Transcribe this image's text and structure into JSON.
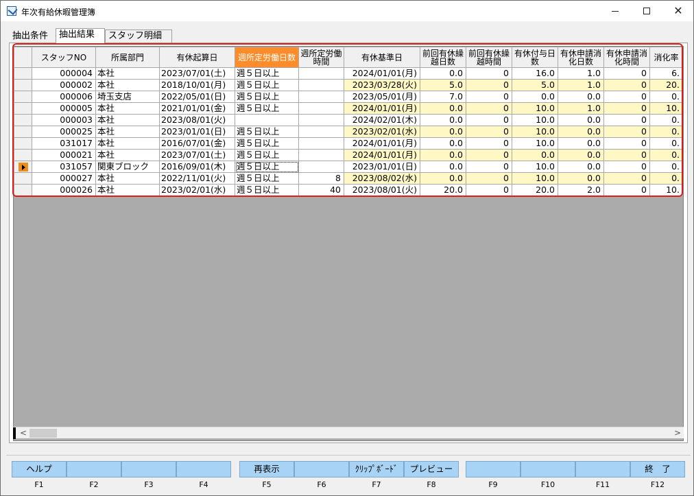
{
  "window": {
    "title": "年次有給休暇管理簿"
  },
  "tabs": [
    {
      "label": "抽出条件"
    },
    {
      "label": "抽出結果"
    },
    {
      "label": "スタッフ明細"
    }
  ],
  "grid": {
    "headers": [
      "スタッフNO",
      "所属部門",
      "有休起算日",
      "週所定労働日数",
      "週所定労働時間",
      "有休基準日",
      "前回有休繰越日数",
      "前回有休繰越時間",
      "有休付与日数",
      "有休申請消化日数",
      "有休申請消化時間",
      "消化率"
    ],
    "rows": [
      {
        "c": [
          "000004",
          "本社",
          "2023/07/01(土)",
          "週５日以上",
          "",
          "2024/01/01(月)",
          "0.0",
          "0",
          "16.0",
          "1.0",
          "0",
          "6."
        ],
        "y": false,
        "current": false
      },
      {
        "c": [
          "000002",
          "本社",
          "2018/10/01(月)",
          "週５日以上",
          "",
          "2023/03/28(火)",
          "5.0",
          "0",
          "5.0",
          "1.0",
          "0",
          "20."
        ],
        "y": true,
        "current": false
      },
      {
        "c": [
          "000006",
          "埼玉支店",
          "2022/05/01(日)",
          "週５日以上",
          "",
          "2023/05/01(月)",
          "7.0",
          "0",
          "0.0",
          "0.0",
          "0",
          "0."
        ],
        "y": false,
        "current": false
      },
      {
        "c": [
          "000005",
          "本社",
          "2021/01/01(金)",
          "週５日以上",
          "",
          "2024/01/01(月)",
          "0.0",
          "0",
          "10.0",
          "1.0",
          "0",
          "10."
        ],
        "y": true,
        "current": false
      },
      {
        "c": [
          "000003",
          "本社",
          "2023/08/01(火)",
          "",
          "",
          "2024/02/01(木)",
          "0.0",
          "0",
          "10.0",
          "0.0",
          "0",
          "0."
        ],
        "y": false,
        "current": false
      },
      {
        "c": [
          "000025",
          "本社",
          "2023/01/01(日)",
          "週５日以上",
          "",
          "2023/02/01(水)",
          "0.0",
          "0",
          "10.0",
          "0.0",
          "0",
          "0."
        ],
        "y": true,
        "current": false
      },
      {
        "c": [
          "031017",
          "本社",
          "2016/07/01(金)",
          "週５日以上",
          "",
          "2024/01/01(月)",
          "0.0",
          "0",
          "10.0",
          "0.0",
          "0",
          "0."
        ],
        "y": false,
        "current": false
      },
      {
        "c": [
          "000021",
          "本社",
          "2023/07/01(土)",
          "週５日以上",
          "",
          "2024/01/01(月)",
          "0.0",
          "0",
          "0.0",
          "0.0",
          "0",
          "0."
        ],
        "y": true,
        "current": false
      },
      {
        "c": [
          "031057",
          "関東ブロック",
          "2016/09/01(木)",
          "週５日以上",
          "",
          "2023/01/01(日)",
          "0.0",
          "0",
          "10.0",
          "0.0",
          "0",
          "0."
        ],
        "y": false,
        "current": true
      },
      {
        "c": [
          "000027",
          "本社",
          "2022/11/01(火)",
          "週５日以上",
          "8",
          "2023/08/02(水)",
          "0.0",
          "0",
          "10.0",
          "0.0",
          "0",
          "0."
        ],
        "y": true,
        "current": false
      },
      {
        "c": [
          "000026",
          "本社",
          "2023/02/01(水)",
          "週５日以上",
          "40",
          "2023/08/01(火)",
          "20.0",
          "0",
          "20.0",
          "2.0",
          "0",
          "10."
        ],
        "y": false,
        "current": false
      }
    ]
  },
  "function_keys": [
    {
      "label": "ヘルプ",
      "key": "F1"
    },
    {
      "label": "",
      "key": "F2"
    },
    {
      "label": "",
      "key": "F3"
    },
    {
      "label": "",
      "key": "F4"
    },
    {
      "label": "再表示",
      "key": "F5"
    },
    {
      "label": "",
      "key": "F6"
    },
    {
      "label": "ｸﾘｯﾌﾟﾎﾞｰﾄﾞ",
      "key": "F7"
    },
    {
      "label": "プレビュー",
      "key": "F8"
    },
    {
      "label": "",
      "key": "F9"
    },
    {
      "label": "",
      "key": "F10"
    },
    {
      "label": "",
      "key": "F11"
    },
    {
      "label": "終　了",
      "key": "F12"
    }
  ],
  "colors": {
    "header_highlight": "#ff8c2a",
    "yellow_cell": "#fff8c4",
    "fkey_button": "#a9d3f5",
    "selection_box": "#e11b1b"
  },
  "icons": {
    "app": "app-icon",
    "current_row": "current-row-arrow-icon"
  }
}
